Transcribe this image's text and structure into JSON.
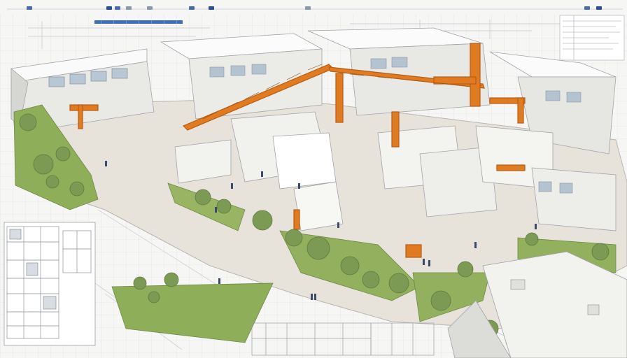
{
  "scene": {
    "kind": "isometric cutaway illustration of an industrial facility",
    "colors": {
      "background": "#f6f6f4",
      "wall": "#ececea",
      "wall_shadow": "#d8d8d4",
      "floor": "#e2dcd4",
      "roof": "#fafafa",
      "crane_orange": "#e07b22",
      "crane_dark": "#b85d12",
      "grass": "#8fae5a",
      "tree": "#7d9a55",
      "line": "#9aa0a6",
      "toolbar_blue": "#3f6fb8"
    },
    "icons": [
      "tree-icon",
      "crane-icon",
      "worker-icon",
      "floor-plan-icon"
    ]
  }
}
